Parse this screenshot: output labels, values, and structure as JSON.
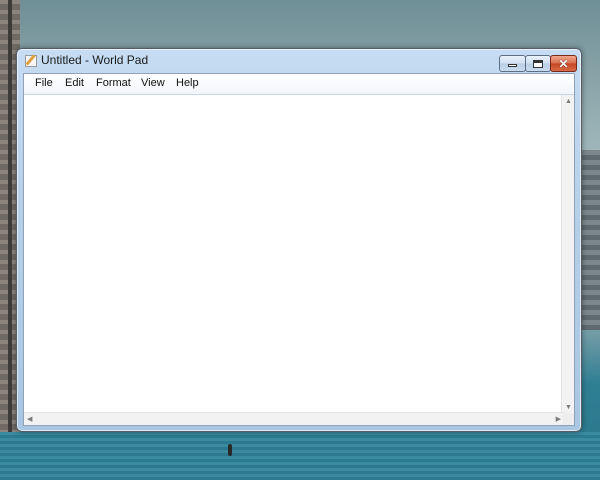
{
  "window": {
    "title": "Untitled - World Pad",
    "controls": {
      "minimize_icon": "minimize-icon",
      "maximize_icon": "maximize-icon",
      "close_icon": "close-icon"
    }
  },
  "menubar": {
    "items": [
      {
        "label": "File"
      },
      {
        "label": "Edit"
      },
      {
        "label": "Format"
      },
      {
        "label": "View"
      },
      {
        "label": "Help"
      }
    ]
  },
  "editor": {
    "content": ""
  },
  "colors": {
    "titlebar": "#b7d0e8",
    "close_button": "#d86c4c",
    "editor_bg": "#ffffff"
  }
}
